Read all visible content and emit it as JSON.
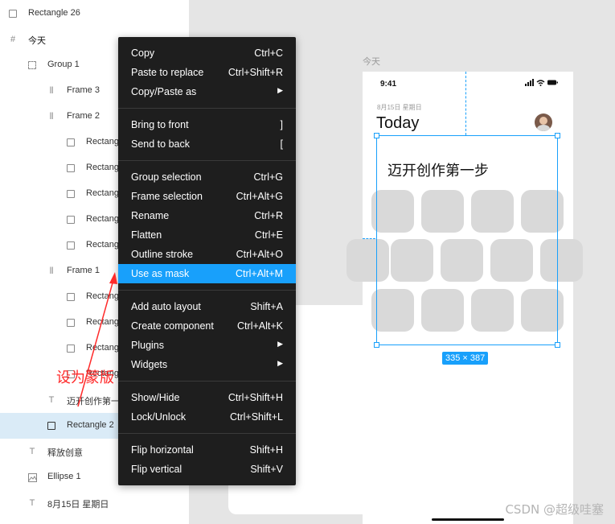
{
  "layers": {
    "items": [
      {
        "label": "Rectangle 26",
        "icon": "rectangle-icon"
      },
      {
        "label": "今天",
        "icon": "frame-hash-icon"
      },
      {
        "label": "Group 1",
        "icon": "group-dashed-icon"
      },
      {
        "label": "Frame 3",
        "icon": "auto-layout-icon"
      },
      {
        "label": "Frame 2",
        "icon": "auto-layout-icon"
      },
      {
        "label": "Rectang",
        "icon": "rectangle-icon"
      },
      {
        "label": "Rectang",
        "icon": "rectangle-icon"
      },
      {
        "label": "Rectang",
        "icon": "rectangle-icon"
      },
      {
        "label": "Rectang",
        "icon": "rectangle-icon"
      },
      {
        "label": "Rectang",
        "icon": "rectangle-icon"
      },
      {
        "label": "Frame 1",
        "icon": "auto-layout-icon"
      },
      {
        "label": "Rectang",
        "icon": "rectangle-icon"
      },
      {
        "label": "Rectang",
        "icon": "rectangle-icon"
      },
      {
        "label": "Rectang",
        "icon": "rectangle-icon"
      },
      {
        "label": "Rectang",
        "icon": "rectangle-icon"
      },
      {
        "label": "迈开创作第一",
        "icon": "text-icon"
      },
      {
        "label": "Rectangle 2",
        "icon": "rectangle-icon"
      },
      {
        "label": "释放创意",
        "icon": "text-icon"
      },
      {
        "label": "Ellipse 1",
        "icon": "image-icon"
      },
      {
        "label": "8月15日 星期日",
        "icon": "text-icon"
      }
    ]
  },
  "canvas": {
    "frame_label": "今天",
    "status_time": "9:41",
    "date_text": "8月15日 星期日",
    "heading": "Today",
    "mask_title": "迈开创作第一步",
    "size_badge": "335 × 387"
  },
  "context_menu": {
    "groups": [
      [
        {
          "label": "Copy",
          "shortcut": "Ctrl+C"
        },
        {
          "label": "Paste to replace",
          "shortcut": "Ctrl+Shift+R"
        },
        {
          "label": "Copy/Paste as",
          "shortcut": "▶"
        }
      ],
      [
        {
          "label": "Bring to front",
          "shortcut": "]"
        },
        {
          "label": "Send to back",
          "shortcut": "["
        }
      ],
      [
        {
          "label": "Group selection",
          "shortcut": "Ctrl+G"
        },
        {
          "label": "Frame selection",
          "shortcut": "Ctrl+Alt+G"
        },
        {
          "label": "Rename",
          "shortcut": "Ctrl+R"
        },
        {
          "label": "Flatten",
          "shortcut": "Ctrl+E"
        },
        {
          "label": "Outline stroke",
          "shortcut": "Ctrl+Alt+O"
        },
        {
          "label": "Use as mask",
          "shortcut": "Ctrl+Alt+M",
          "active": true
        }
      ],
      [
        {
          "label": "Add auto layout",
          "shortcut": "Shift+A"
        },
        {
          "label": "Create component",
          "shortcut": "Ctrl+Alt+K"
        },
        {
          "label": "Plugins",
          "shortcut": "▶"
        },
        {
          "label": "Widgets",
          "shortcut": "▶"
        }
      ],
      [
        {
          "label": "Show/Hide",
          "shortcut": "Ctrl+Shift+H"
        },
        {
          "label": "Lock/Unlock",
          "shortcut": "Ctrl+Shift+L"
        }
      ],
      [
        {
          "label": "Flip horizontal",
          "shortcut": "Shift+H"
        },
        {
          "label": "Flip vertical",
          "shortcut": "Shift+V"
        }
      ]
    ]
  },
  "annotation": {
    "text": "设为蒙版"
  },
  "watermark": {
    "text": "CSDN @超级哇塞"
  },
  "colors": {
    "accent": "#18a0fb",
    "menu_bg": "#1e1e1e",
    "annotation": "#ff2a2a",
    "selection_row": "#daebf7"
  }
}
